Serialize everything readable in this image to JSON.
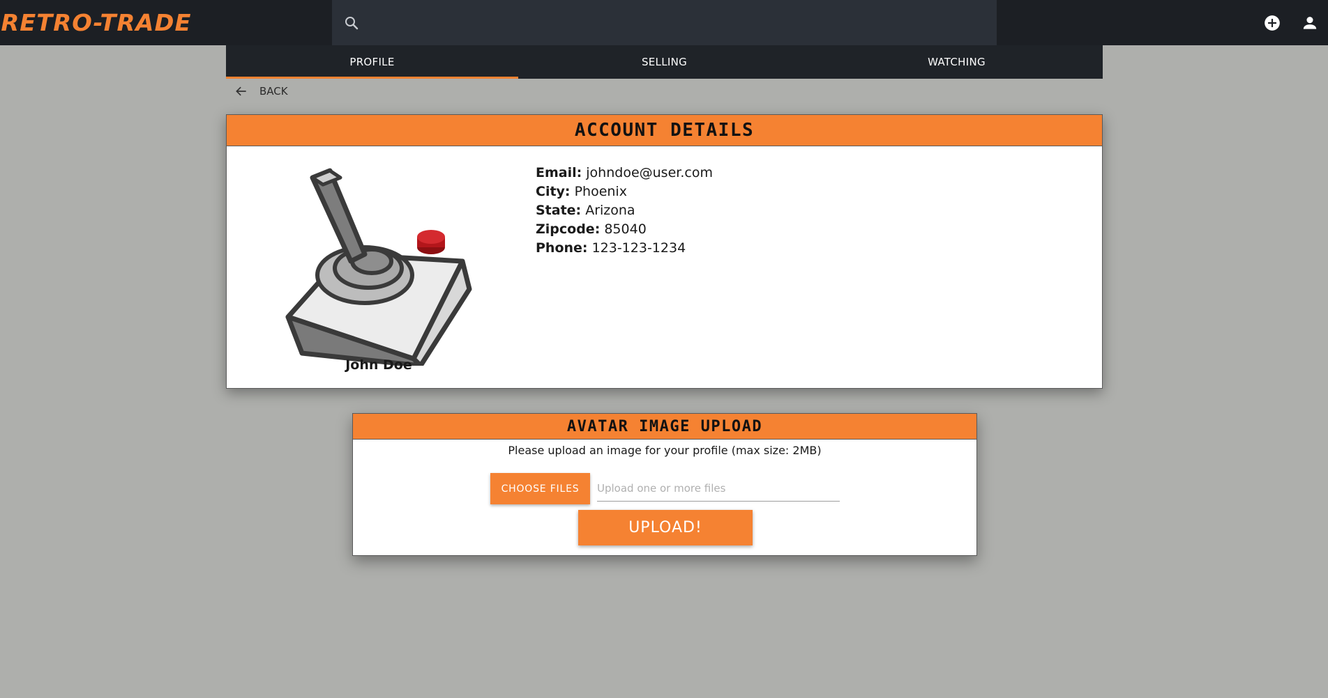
{
  "app": {
    "logo": "RETRO-TRADE",
    "brand_color": "#f58232"
  },
  "header": {
    "search": {
      "placeholder": "",
      "icon": "search-icon"
    },
    "icons": [
      "add-circle-icon",
      "user-icon"
    ]
  },
  "tabs": [
    {
      "label": "PROFILE",
      "active": true
    },
    {
      "label": "SELLING",
      "active": false
    },
    {
      "label": "WATCHING",
      "active": false
    }
  ],
  "back": {
    "label": "BACK",
    "icon": "arrow-left-icon"
  },
  "account": {
    "title": "ACCOUNT DETAILS",
    "avatar_icon": "joystick-icon",
    "name": "John Doe",
    "fields": [
      {
        "label": "Email:",
        "value": "johndoe@user.com"
      },
      {
        "label": "City:",
        "value": "Phoenix"
      },
      {
        "label": "State:",
        "value": "Arizona"
      },
      {
        "label": "Zipcode:",
        "value": "85040"
      },
      {
        "label": "Phone:",
        "value": "123-123-1234"
      }
    ]
  },
  "upload": {
    "title": "AVATAR IMAGE UPLOAD",
    "description": "Please upload an image for your profile (max size: 2MB)",
    "choose_label": "CHOOSE FILES",
    "file_placeholder": "Upload one or more files",
    "submit_label": "UPLOAD!"
  }
}
